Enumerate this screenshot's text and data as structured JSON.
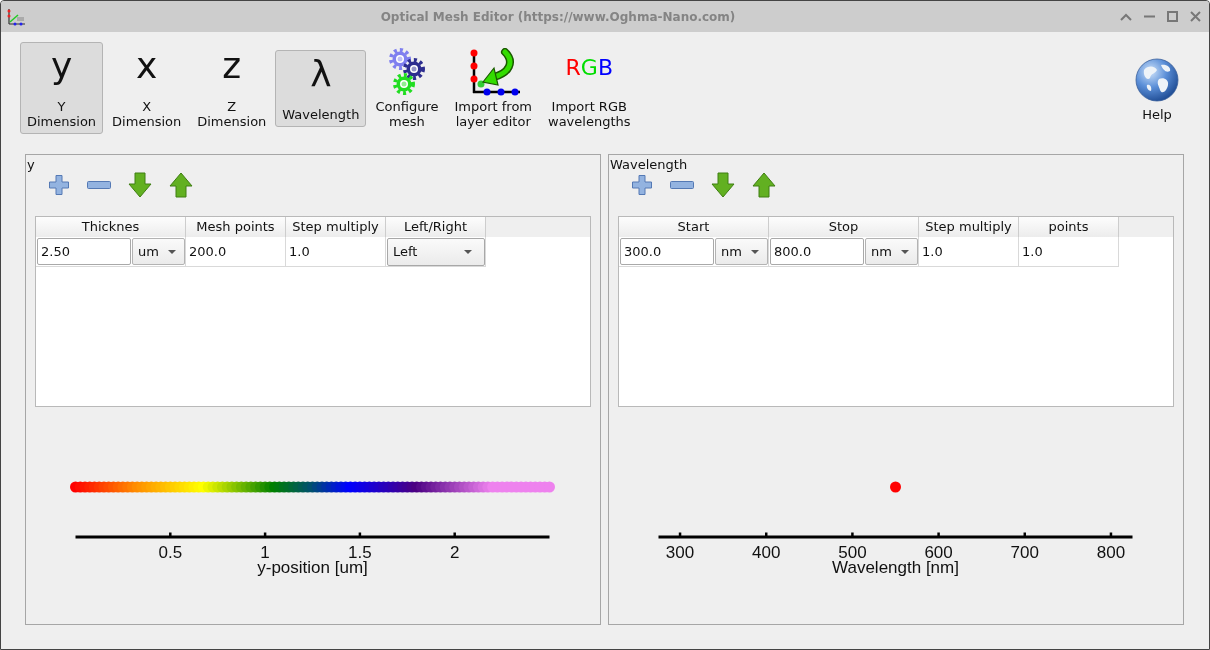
{
  "window": {
    "title": "Optical Mesh Editor (https://www.Oghma-Nano.com)"
  },
  "toolbar": {
    "buttons": [
      {
        "kind": "glyph",
        "glyph": "y",
        "label": "Y\nDimension",
        "selected": true
      },
      {
        "kind": "glyph",
        "glyph": "x",
        "label": "X\nDimension",
        "selected": false
      },
      {
        "kind": "glyph",
        "glyph": "z",
        "label": "Z\nDimension",
        "selected": false
      },
      {
        "kind": "glyph",
        "glyph": "λ",
        "label": "Wavelength",
        "selected": true
      },
      {
        "kind": "gears",
        "label": "Configure\nmesh",
        "selected": false
      },
      {
        "kind": "import",
        "label": "Import from\nlayer editor",
        "selected": false
      },
      {
        "kind": "rgb",
        "glyph": "RGB",
        "label": "Import RGB\nwavelengths",
        "selected": false
      }
    ],
    "help": {
      "label": "Help"
    }
  },
  "panels": [
    {
      "title": "y",
      "table": {
        "columns": [
          "Thicknes",
          "Mesh points",
          "Step multiply",
          "Left/Right"
        ],
        "rows": [
          [
            {
              "kind": "input_unit",
              "value": "2.50",
              "unit": "um"
            },
            {
              "kind": "text",
              "value": "200.0"
            },
            {
              "kind": "text",
              "value": "1.0"
            },
            {
              "kind": "dropdown",
              "value": "Left"
            }
          ]
        ]
      },
      "plot": {
        "kind": "mesh_points",
        "tick_labels": [
          "0.5",
          "1",
          "1.5",
          "2"
        ],
        "axis_title": "y-position [um]"
      }
    },
    {
      "title": "Wavelength",
      "table": {
        "columns": [
          "Start",
          "Stop",
          "Step multiply",
          "points"
        ],
        "rows": [
          [
            {
              "kind": "input_unit",
              "value": "300.0",
              "unit": "nm"
            },
            {
              "kind": "input_unit",
              "value": "800.0",
              "unit": "nm"
            },
            {
              "kind": "text",
              "value": "1.0"
            },
            {
              "kind": "text",
              "value": "1.0"
            }
          ]
        ]
      },
      "plot": {
        "kind": "single_point",
        "tick_labels": [
          "300",
          "400",
          "500",
          "600",
          "700",
          "800"
        ],
        "axis_title": "Wavelength [nm]"
      }
    }
  ]
}
